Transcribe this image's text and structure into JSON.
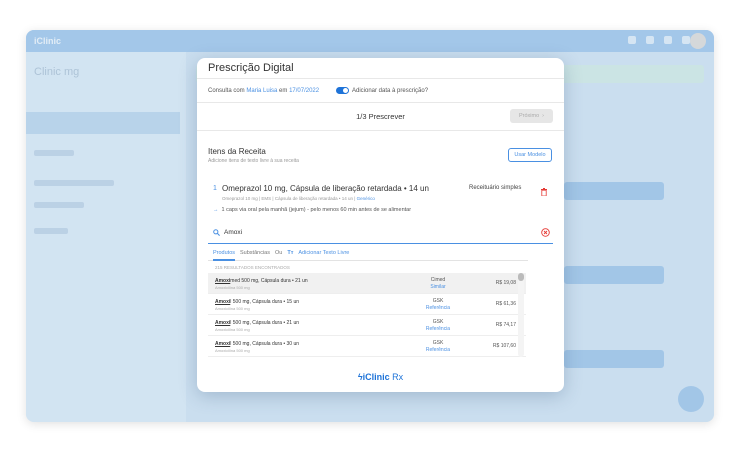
{
  "modal": {
    "title": "Prescrição Digital",
    "consult_prefix": "Consulta com",
    "patient_name": "Maria Luisa",
    "consult_mid": "em",
    "consult_date": "17/07/2022",
    "toggle_label": "Adicionar data à prescrição?",
    "step_label": "1/3 Prescrever",
    "next_label": "Próximo",
    "items_title": "Itens da Receita",
    "items_subtitle": "Adicione itens de texto livre à sua receita",
    "model_button": "Usar Modelo"
  },
  "prescription_item": {
    "number": "1",
    "name": "Omeprazol 10 mg, Cápsula de liberação retardada • 14 un",
    "type": "Receituário simples",
    "meta": "Omeprazol 10 mg | EMS | Cápsula de liberação retardada • 14 un |",
    "meta_link": "Genérico",
    "posology": "1 caps via oral pela manhã (jejum) - pelo menos 60 min antes de se alimentar"
  },
  "search": {
    "value": "Amoxi",
    "tabs": [
      "Produtos",
      "Substâncias",
      "Ou"
    ],
    "free_text": "Adicionar Texto Livre",
    "results_label": "215 RESULTADOS ENCONTRADOS"
  },
  "results": [
    {
      "name_bold": "Amoxi",
      "name_rest": "med 500 mg, Cápsula dura • 21 un",
      "sub": "Amoxicilina 500 mg",
      "lab": "Cimed",
      "category": "Similar",
      "price": "R$ 19,08"
    },
    {
      "name_bold": "Amoxi",
      "name_rest": "l 500 mg, Cápsula dura • 15 un",
      "sub": "Amoxicilina 500 mg",
      "lab": "GSK",
      "category": "Referência",
      "price": "R$ 61,36"
    },
    {
      "name_bold": "Amoxi",
      "name_rest": "l 500 mg, Cápsula dura • 21 un",
      "sub": "Amoxicilina 500 mg",
      "lab": "GSK",
      "category": "Referência",
      "price": "R$ 74,17"
    },
    {
      "name_bold": "Amoxi",
      "name_rest": "l 500 mg, Cápsula dura • 30 un",
      "sub": "Amoxicilina 500 mg",
      "lab": "GSK",
      "category": "Referência",
      "price": "R$ 107,60"
    }
  ],
  "footer": {
    "brand": "iClinic",
    "suffix": " Rx"
  },
  "background": {
    "app_logo": "iClinic",
    "sidebar_title": "Clinic mg"
  },
  "colors": {
    "accent": "#4a90e2",
    "brand": "#1e73d8",
    "danger": "#e53935"
  }
}
